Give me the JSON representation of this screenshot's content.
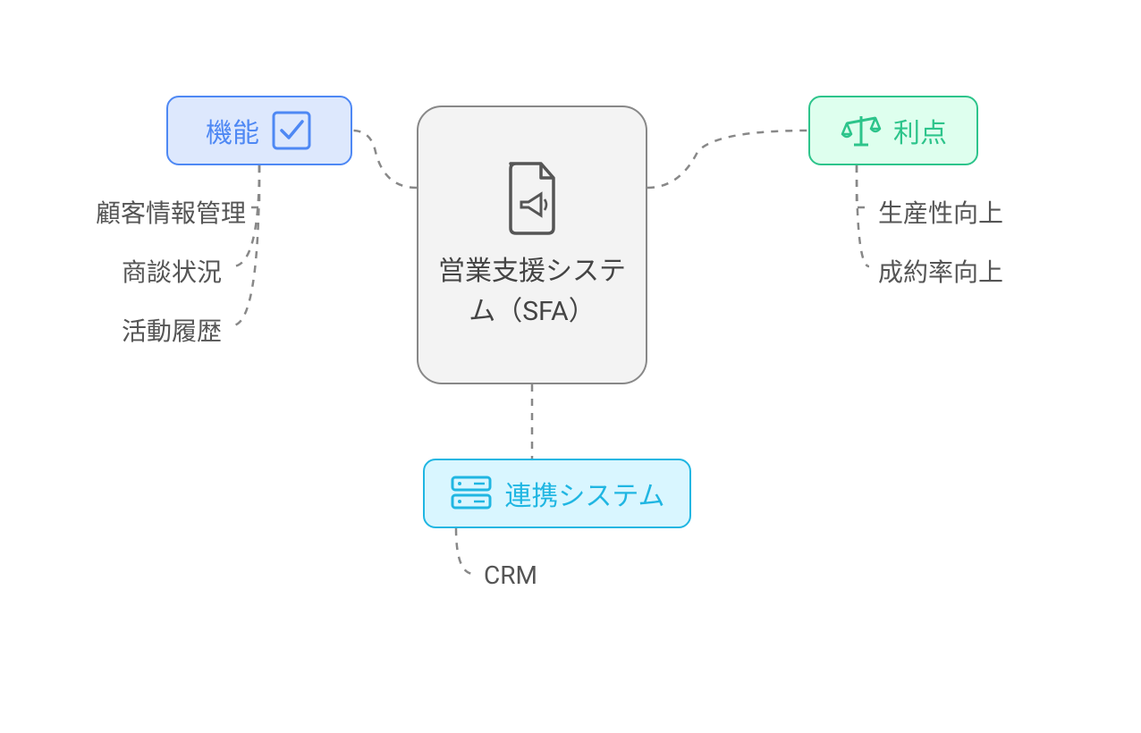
{
  "center": {
    "title": "営業支援システム（SFA）"
  },
  "features": {
    "label": "機能",
    "children": [
      "顧客情報管理",
      "商談状況",
      "活動履歴"
    ]
  },
  "benefits": {
    "label": "利点",
    "children": [
      "生産性向上",
      "成約率向上"
    ]
  },
  "systems": {
    "label": "連携システム",
    "children": [
      "CRM"
    ]
  }
}
